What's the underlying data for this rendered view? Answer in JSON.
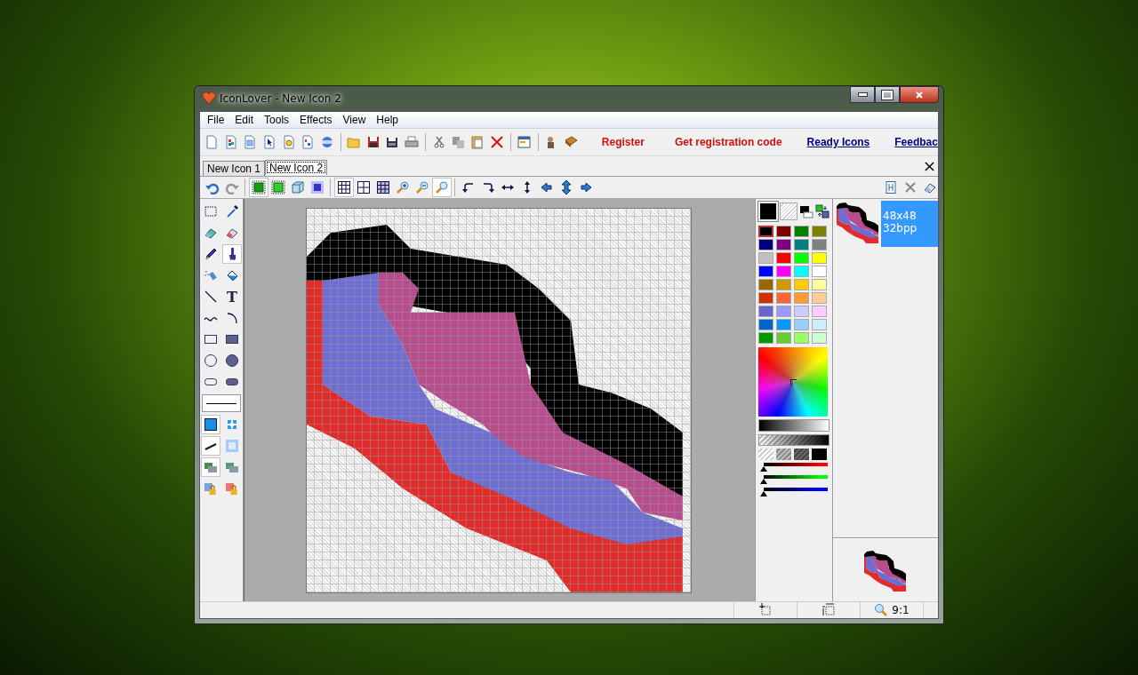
{
  "window": {
    "title": "IconLover - New Icon 2"
  },
  "menu": [
    "File",
    "Edit",
    "Tools",
    "Effects",
    "View",
    "Help"
  ],
  "toolbar_links": [
    {
      "label": "Register",
      "kind": "action"
    },
    {
      "label": "Get registration code",
      "kind": "action"
    },
    {
      "label": "Ready Icons",
      "kind": "link"
    },
    {
      "label": "Feedbac",
      "kind": "link"
    }
  ],
  "tabs": [
    {
      "label": "New Icon 1",
      "selected": false
    },
    {
      "label": "New Icon 2",
      "selected": true
    }
  ],
  "view_tools": [
    {
      "kind": "undo",
      "selected": false
    },
    {
      "kind": "redo",
      "selected": false
    },
    {
      "kind": "frame",
      "selected": true
    },
    {
      "kind": "frame2",
      "selected": false
    },
    {
      "kind": "cube",
      "selected": false
    },
    {
      "kind": "glow",
      "selected": false
    },
    {
      "kind": "grid",
      "selected": true
    },
    {
      "kind": "grid-big",
      "selected": false
    },
    {
      "kind": "grid-hatch",
      "selected": false
    },
    {
      "kind": "zoom-in",
      "selected": false
    },
    {
      "kind": "zoom-out",
      "selected": false
    },
    {
      "kind": "zoom-fit",
      "selected": true
    },
    {
      "kind": "rotate-left",
      "selected": false
    },
    {
      "kind": "rotate-right",
      "selected": false
    },
    {
      "kind": "flip-h",
      "selected": false
    },
    {
      "kind": "flip-v",
      "selected": false
    },
    {
      "kind": "move-left",
      "selected": false
    },
    {
      "kind": "move-updown",
      "selected": false
    },
    {
      "kind": "move-right",
      "selected": false
    }
  ],
  "tools": [
    {
      "kind": "select",
      "selected": false
    },
    {
      "kind": "picker",
      "selected": false
    },
    {
      "kind": "color-eraser",
      "selected": false
    },
    {
      "kind": "eraser",
      "selected": false
    },
    {
      "kind": "pencil",
      "selected": false
    },
    {
      "kind": "brush",
      "selected": true
    },
    {
      "kind": "spray",
      "selected": false
    },
    {
      "kind": "fill",
      "selected": false
    },
    {
      "kind": "line",
      "selected": false
    },
    {
      "kind": "text",
      "label": "T",
      "selected": false
    },
    {
      "kind": "curve",
      "selected": false
    },
    {
      "kind": "arc",
      "selected": false
    },
    {
      "kind": "rect",
      "selected": false
    },
    {
      "kind": "rect-fill",
      "selected": false
    },
    {
      "kind": "ellipse",
      "selected": false
    },
    {
      "kind": "ellipse-fill",
      "selected": false
    },
    {
      "kind": "round",
      "selected": false
    },
    {
      "kind": "round-fill",
      "selected": false
    },
    {
      "kind": "line-width",
      "selected": false
    },
    {
      "kind": "solid-fill",
      "selected": true
    },
    {
      "kind": "pattern",
      "selected": false
    },
    {
      "kind": "smooth",
      "selected": true
    },
    {
      "kind": "gradient",
      "selected": false
    },
    {
      "kind": "layer",
      "selected": true
    },
    {
      "kind": "layer2",
      "selected": false
    },
    {
      "kind": "lock",
      "selected": false
    },
    {
      "kind": "lock2",
      "selected": false
    }
  ],
  "palette": [
    {
      "color": "#000000",
      "selected": true
    },
    {
      "color": "#800000",
      "selected": false
    },
    {
      "color": "#008000",
      "selected": false
    },
    {
      "color": "#808000",
      "selected": false
    },
    {
      "color": "#000080",
      "selected": false
    },
    {
      "color": "#800080",
      "selected": false
    },
    {
      "color": "#008080",
      "selected": false
    },
    {
      "color": "#808080",
      "selected": false
    },
    {
      "color": "#c0c0c0",
      "selected": false
    },
    {
      "color": "#ff0000",
      "selected": false
    },
    {
      "color": "#00ff00",
      "selected": false
    },
    {
      "color": "#ffff00",
      "selected": false
    },
    {
      "color": "#0000ff",
      "selected": false
    },
    {
      "color": "#ff00ff",
      "selected": false
    },
    {
      "color": "#00ffff",
      "selected": false
    },
    {
      "color": "#ffffff",
      "selected": false
    },
    {
      "color": "#996600",
      "selected": false
    },
    {
      "color": "#cc9900",
      "selected": false
    },
    {
      "color": "#ffcc00",
      "selected": false
    },
    {
      "color": "#ffff99",
      "selected": false
    },
    {
      "color": "#cc3300",
      "selected": false
    },
    {
      "color": "#ff6633",
      "selected": false
    },
    {
      "color": "#ff9933",
      "selected": false
    },
    {
      "color": "#ffcc99",
      "selected": false
    },
    {
      "color": "#6666cc",
      "selected": false
    },
    {
      "color": "#9999ff",
      "selected": false
    },
    {
      "color": "#ccccff",
      "selected": false
    },
    {
      "color": "#ffccff",
      "selected": false
    },
    {
      "color": "#0066cc",
      "selected": false
    },
    {
      "color": "#0099ff",
      "selected": false
    },
    {
      "color": "#99ccff",
      "selected": false
    },
    {
      "color": "#cceeff",
      "selected": false
    },
    {
      "color": "#009900",
      "selected": false
    },
    {
      "color": "#66cc33",
      "selected": false
    },
    {
      "color": "#99ff66",
      "selected": false
    },
    {
      "color": "#ccffcc",
      "selected": false
    }
  ],
  "channels": [
    {
      "color": "#ff0000",
      "level": 0
    },
    {
      "color": "#00ff00",
      "level": 0
    },
    {
      "color": "#0000ff",
      "level": 0
    }
  ],
  "formats": [
    {
      "size": "48x48",
      "depth": "32bpp",
      "selected": true
    }
  ],
  "status_bar": {
    "zoom": "9:1"
  }
}
